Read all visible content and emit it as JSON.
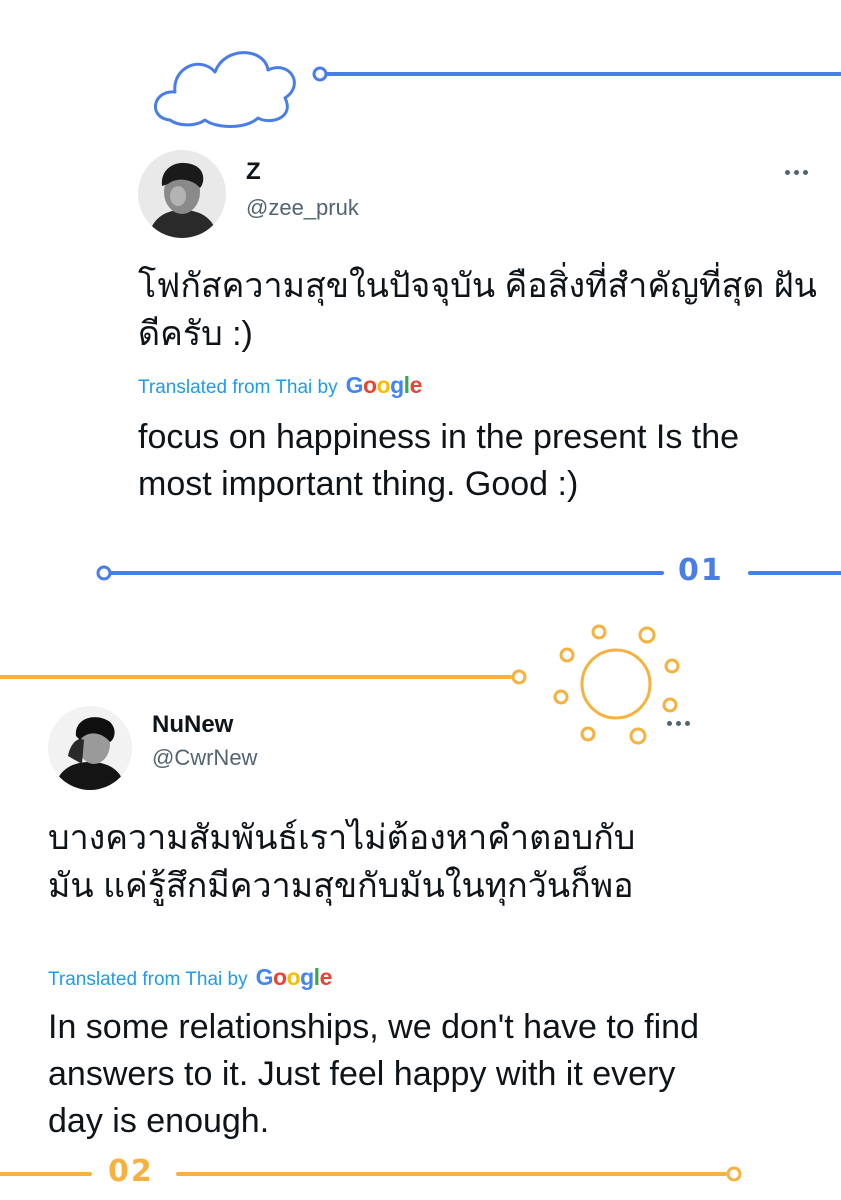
{
  "colors": {
    "blue_accent": "#4a7de6",
    "orange_accent": "#f6b13e",
    "twitter_blue": "#1d9bf0",
    "handle_gray": "#536471",
    "google_blue": "#4285f4",
    "google_red": "#ea4335",
    "google_yellow": "#fbbc05",
    "google_green": "#34a853"
  },
  "tweets": [
    {
      "display_name": "Z",
      "handle": "@zee_pruk",
      "text_thai": "โฟกัสความสุขในปัจจุบัน คือสิ่งที่สำคัญที่สุด ฝันดีครับ :)",
      "translated_label": "Translated from Thai by",
      "translation": "focus on happiness in the present Is the most important thing. Good :)",
      "more_icon": "more-horizontal-icon"
    },
    {
      "display_name": "NuNew",
      "handle": "@CwrNew",
      "text_thai": "บางความสัมพันธ์เราไม่ต้องหาคำตอบกับมัน แค่รู้สึกมีความสุขกับมันในทุกวันก็พอ",
      "translated_label": "Translated from Thai by",
      "translation": "In some relationships, we don't have to find answers to it. Just feel happy with it every day is enough.",
      "more_icon": "more-horizontal-icon"
    }
  ],
  "google_logo": {
    "letters": [
      "G",
      "o",
      "o",
      "g",
      "l",
      "e"
    ]
  },
  "section_numbers": [
    "01",
    "02"
  ]
}
